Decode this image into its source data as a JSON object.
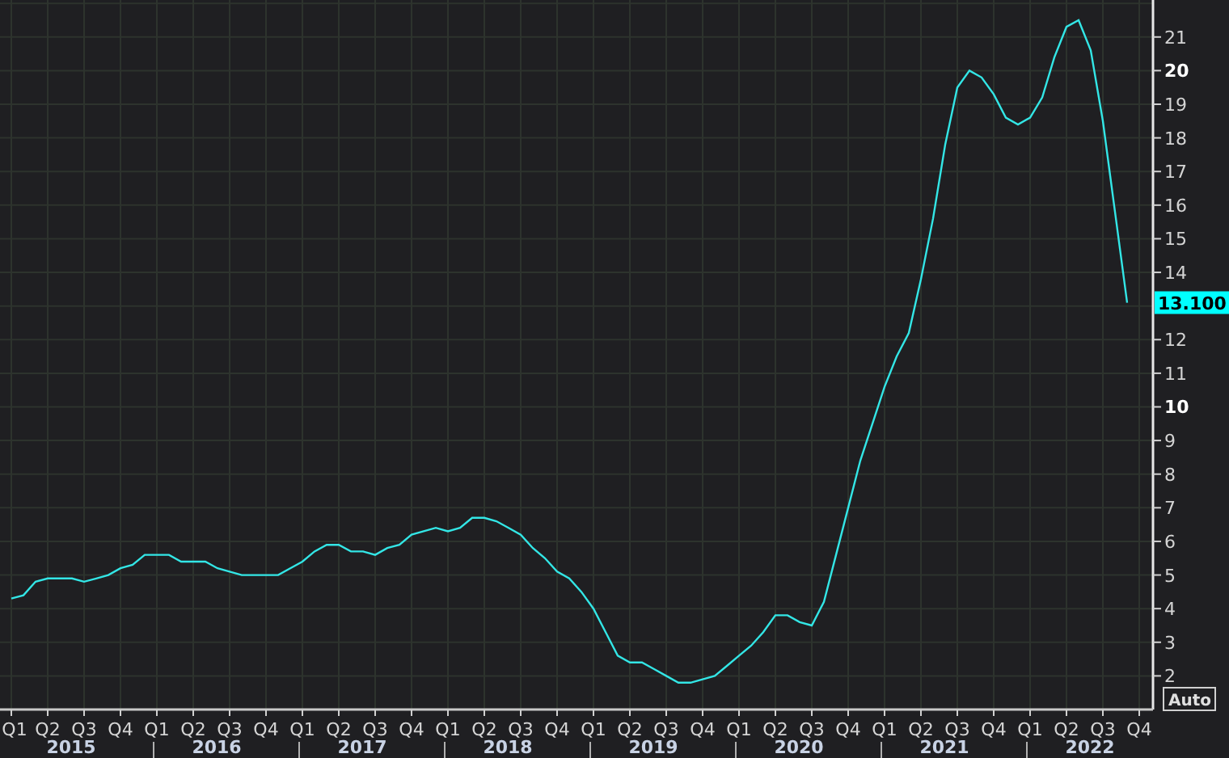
{
  "chart_data": {
    "type": "line",
    "categories": [
      "Q1",
      null,
      null,
      "Q2",
      null,
      null,
      "Q3",
      null,
      null,
      "Q4",
      null,
      null,
      "Q1",
      null,
      null,
      "Q2",
      null,
      null,
      "Q3",
      null,
      null,
      "Q4",
      null,
      null,
      "Q1",
      null,
      null,
      "Q2",
      null,
      null,
      "Q3",
      null,
      null,
      "Q4",
      null,
      null,
      "Q1",
      null,
      null,
      "Q2",
      null,
      null,
      "Q3",
      null,
      null,
      "Q4",
      null,
      null,
      "Q1",
      null,
      null,
      "Q2",
      null,
      null,
      "Q3",
      null,
      null,
      "Q4",
      null,
      null,
      "Q1",
      null,
      null,
      "Q2",
      null,
      null,
      "Q3",
      null,
      null,
      "Q4",
      null,
      null,
      "Q1",
      null,
      null,
      "Q2",
      null,
      null,
      "Q3",
      null,
      null,
      "Q4",
      null,
      null,
      "Q1",
      null,
      null,
      "Q2",
      null,
      null,
      "Q3",
      null,
      null,
      "Q4"
    ],
    "series": [
      {
        "color": "#33e6e6",
        "values": [
          4.3,
          4.4,
          4.8,
          4.9,
          4.9,
          4.9,
          4.8,
          4.9,
          5.0,
          5.2,
          5.3,
          5.6,
          5.6,
          5.6,
          5.4,
          5.4,
          5.4,
          5.2,
          5.1,
          5.0,
          5.0,
          5.0,
          5.0,
          5.2,
          5.4,
          5.7,
          5.9,
          5.9,
          5.7,
          5.7,
          5.6,
          5.8,
          5.9,
          6.2,
          6.3,
          6.4,
          6.3,
          6.4,
          6.7,
          6.7,
          6.6,
          6.4,
          6.2,
          5.8,
          5.5,
          5.1,
          4.9,
          4.5,
          4.0,
          3.3,
          2.6,
          2.4,
          2.4,
          2.2,
          2.0,
          1.8,
          1.8,
          1.9,
          2.0,
          2.3,
          2.6,
          2.9,
          3.3,
          3.8,
          3.8,
          3.6,
          3.5,
          4.2,
          5.6,
          7.0,
          8.4,
          9.5,
          10.6,
          11.5,
          12.2,
          13.8,
          15.6,
          17.8,
          19.5,
          20.0,
          19.8,
          19.3,
          18.6,
          18.4,
          18.6,
          19.2,
          20.4,
          21.3,
          21.5,
          20.6,
          18.5,
          15.8,
          13.1,
          null
        ]
      }
    ],
    "ylim": [
      1.0,
      22.1
    ],
    "grid": true,
    "yticks": [
      2,
      3,
      4,
      5,
      6,
      7,
      8,
      9,
      10,
      11,
      12,
      14,
      15,
      16,
      17,
      18,
      19,
      20,
      21
    ]
  },
  "year_labels": [
    "2015",
    "2016",
    "2017",
    "2018",
    "2019",
    "2020",
    "2021",
    "2022"
  ],
  "last_value_label": "13.100",
  "scale_button": "Auto"
}
